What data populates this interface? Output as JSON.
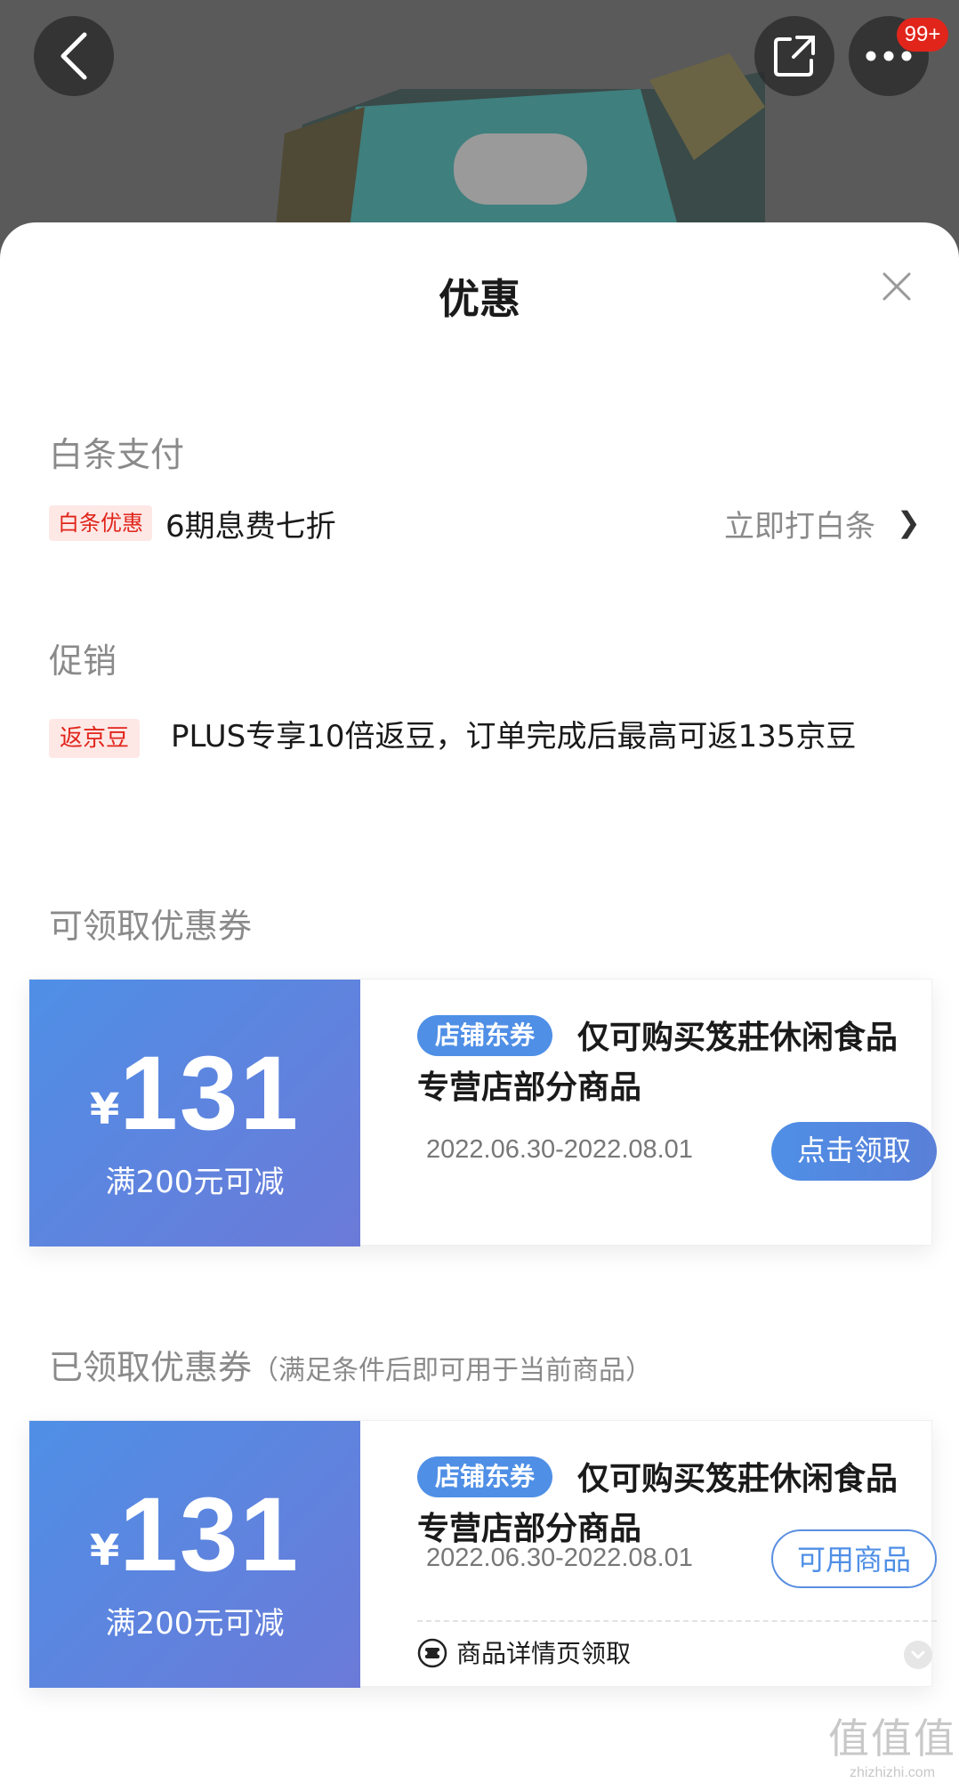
{
  "header": {
    "badge": "99+",
    "icons": [
      "back-icon",
      "share-icon",
      "more-icon"
    ]
  },
  "sheet": {
    "title": "优惠"
  },
  "baitiao": {
    "section_title": "白条支付",
    "tag": "白条优惠",
    "text": "6期息费七折",
    "link": "立即打白条",
    "chevron": "❯"
  },
  "promo": {
    "section_title": "促销",
    "tag": "返京豆",
    "text": "PLUS专享10倍返豆，订单完成后最高可返135京豆"
  },
  "available": {
    "section_title": "可领取优惠券",
    "coupon": {
      "currency": "¥",
      "amount": "131",
      "condition": "满200元可减",
      "tag": "店铺东券",
      "desc": "仅可购买笈莊休闲食品专营店部分商品",
      "date": "2022.06.30-2022.08.01",
      "button": "点击领取"
    }
  },
  "claimed": {
    "section_title": "已领取优惠券",
    "note": "（满足条件后即可用于当前商品）",
    "coupon": {
      "currency": "¥",
      "amount": "131",
      "condition": "满200元可减",
      "tag": "店铺东券",
      "desc": "仅可购买笈莊休闲食品专营店部分商品",
      "date": "2022.06.30-2022.08.01",
      "button": "可用商品",
      "source": "商品详情页领取"
    }
  },
  "watermark": {
    "main": "值值值",
    "sub": "zhizhizhi.com"
  },
  "colors": {
    "accent": "#e1251b",
    "coupon_blue": "#4f8fe6",
    "coupon_purple": "#6b7ad8"
  }
}
